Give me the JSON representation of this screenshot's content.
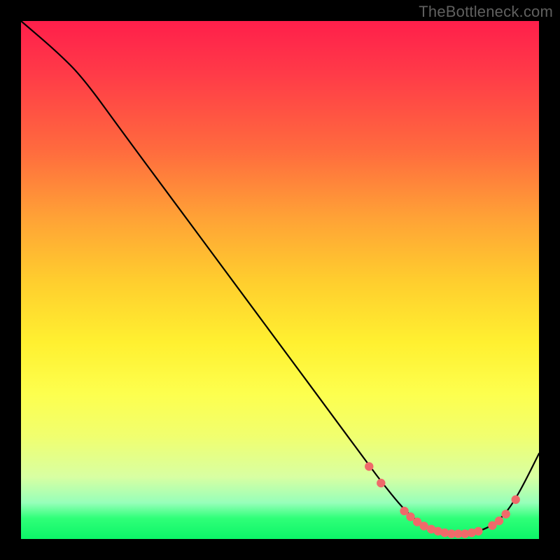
{
  "watermark": "TheBottleneck.com",
  "chart_data": {
    "type": "line",
    "title": "",
    "xlabel": "",
    "ylabel": "",
    "xlim": [
      0,
      100
    ],
    "ylim": [
      0,
      100
    ],
    "grid": false,
    "background": "rainbow-vertical",
    "series": [
      {
        "name": "curve",
        "x": [
          0,
          7,
          12,
          20,
          30,
          40,
          50,
          60,
          67,
          70,
          73,
          75,
          77,
          79,
          81,
          83,
          85,
          87,
          89,
          91,
          93,
          95,
          97,
          100
        ],
        "y": [
          100,
          94,
          89,
          78,
          64.5,
          51,
          37.5,
          24,
          14.5,
          10.5,
          6.8,
          4.7,
          3.1,
          2.0,
          1.3,
          1.0,
          1.0,
          1.2,
          1.7,
          2.7,
          4.3,
          7.0,
          10.5,
          16.5
        ]
      }
    ],
    "markers": {
      "name": "flat-region-dots",
      "color": "#ef6a6a",
      "points": [
        {
          "x": 67.2,
          "y": 14.0
        },
        {
          "x": 69.5,
          "y": 10.8
        },
        {
          "x": 74.0,
          "y": 5.4
        },
        {
          "x": 75.2,
          "y": 4.3
        },
        {
          "x": 76.5,
          "y": 3.3
        },
        {
          "x": 77.8,
          "y": 2.5
        },
        {
          "x": 79.2,
          "y": 1.9
        },
        {
          "x": 80.5,
          "y": 1.5
        },
        {
          "x": 81.8,
          "y": 1.2
        },
        {
          "x": 83.1,
          "y": 1.0
        },
        {
          "x": 84.4,
          "y": 1.0
        },
        {
          "x": 85.7,
          "y": 1.0
        },
        {
          "x": 87.0,
          "y": 1.2
        },
        {
          "x": 88.3,
          "y": 1.5
        },
        {
          "x": 91.0,
          "y": 2.6
        },
        {
          "x": 92.3,
          "y": 3.5
        },
        {
          "x": 93.6,
          "y": 4.8
        },
        {
          "x": 95.5,
          "y": 7.6
        }
      ]
    }
  }
}
